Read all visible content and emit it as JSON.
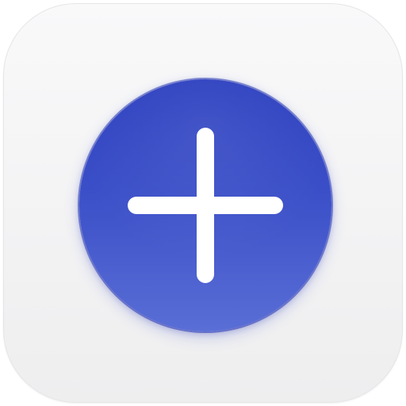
{
  "app_icon": {
    "icon": "plus-icon",
    "colors": {
      "tile_background": "#f3f3f4",
      "button_top": "#2c3fbf",
      "button_bottom": "#5a6ed6",
      "glyph": "#ffffff"
    }
  }
}
